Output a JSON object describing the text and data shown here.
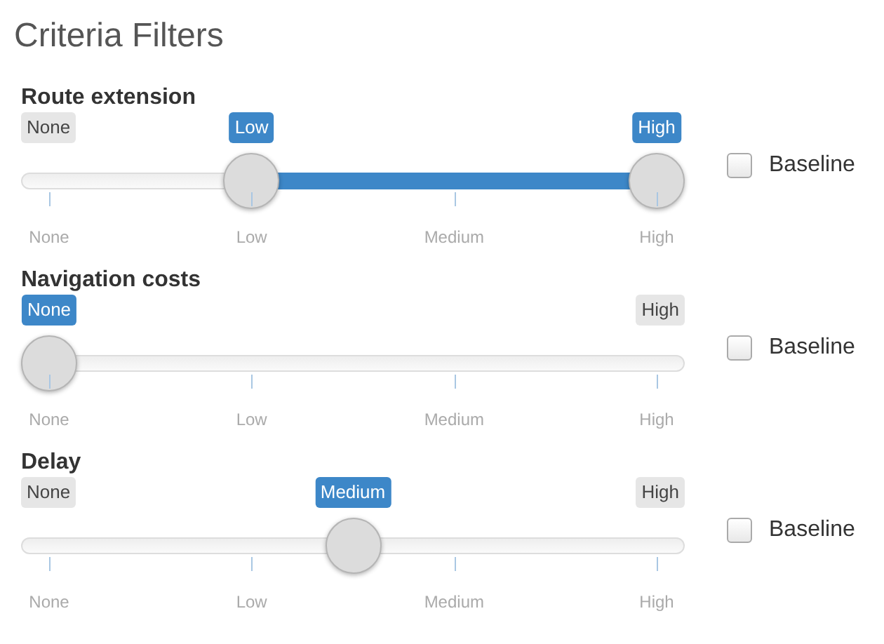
{
  "title": "Criteria Filters",
  "filters": [
    {
      "label": "Route extension",
      "kind": "range",
      "min_label": "None",
      "handles": [
        {
          "label": "Low",
          "level": 0.3333
        },
        {
          "label": "High",
          "level": 1
        }
      ],
      "ticks": [
        "None",
        "Low",
        "Medium",
        "High"
      ],
      "baseline": {
        "label": "Baseline",
        "checked": false
      }
    },
    {
      "label": "Navigation costs",
      "kind": "single",
      "max_label": "High",
      "handles": [
        {
          "label": "None",
          "level": 0
        }
      ],
      "ticks": [
        "None",
        "Low",
        "Medium",
        "High"
      ],
      "baseline": {
        "label": "Baseline",
        "checked": false
      }
    },
    {
      "label": "Delay",
      "kind": "single",
      "min_label": "None",
      "max_label": "High",
      "handles": [
        {
          "label": "Medium",
          "level": 0.5
        }
      ],
      "ticks": [
        "None",
        "Low",
        "Medium",
        "High"
      ],
      "baseline": {
        "label": "Baseline",
        "checked": false
      }
    }
  ]
}
